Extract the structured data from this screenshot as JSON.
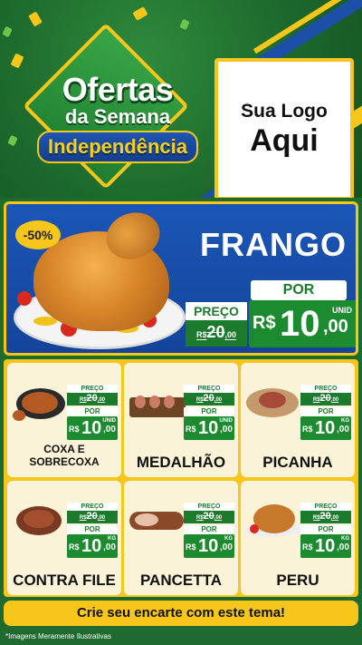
{
  "header": {
    "title_line1": "Ofertas",
    "title_line2": "da Semana",
    "title_da": "da",
    "title_line3": "Independência",
    "logo_line1": "Sua Logo",
    "logo_line2": "Aqui"
  },
  "hero": {
    "discount": "-50%",
    "name": "FRANGO",
    "preco_label": "PREÇO",
    "old_currency": "R$",
    "old_int": "20",
    "old_dec": ",00",
    "por_label": "POR",
    "currency": "R$",
    "price_int": "10",
    "price_dec": ",00",
    "unit": "UNID"
  },
  "products": [
    {
      "name": "COXA E SOBRECOXA",
      "preco_label": "PREÇO",
      "old_currency": "R$",
      "old_int": "20",
      "old_dec": ",00",
      "por_label": "POR",
      "currency": "R$",
      "price_int": "10",
      "price_dec": ",00",
      "unit": "UNID"
    },
    {
      "name": "MEDALHÃO",
      "preco_label": "PREÇO",
      "old_currency": "R$",
      "old_int": "20",
      "old_dec": ",00",
      "por_label": "POR",
      "currency": "R$",
      "price_int": "10",
      "price_dec": ",00",
      "unit": "UNID"
    },
    {
      "name": "PICANHA",
      "preco_label": "PREÇO",
      "old_currency": "R$",
      "old_int": "20",
      "old_dec": ",00",
      "por_label": "POR",
      "currency": "R$",
      "price_int": "10",
      "price_dec": ",00",
      "unit": "KG"
    },
    {
      "name": "CONTRA FILE",
      "preco_label": "PREÇO",
      "old_currency": "R$",
      "old_int": "20",
      "old_dec": ",00",
      "por_label": "POR",
      "currency": "R$",
      "price_int": "10",
      "price_dec": ",00",
      "unit": "KG"
    },
    {
      "name": "PANCETTA",
      "preco_label": "PREÇO",
      "old_currency": "R$",
      "old_int": "20",
      "old_dec": ",00",
      "por_label": "POR",
      "currency": "R$",
      "price_int": "10",
      "price_dec": ",00",
      "unit": "KG"
    },
    {
      "name": "PERU",
      "preco_label": "PREÇO",
      "old_currency": "R$",
      "old_int": "20",
      "old_dec": ",00",
      "por_label": "POR",
      "currency": "R$",
      "price_int": "10",
      "price_dec": ",00",
      "unit": "KG"
    }
  ],
  "footer": {
    "cta": "Crie seu encarte com este tema!",
    "disclaimer": "*Imagens Meramente Ilustrativas"
  },
  "colors": {
    "green_bg": "#1f6b2f",
    "blue_panel": "#1b56b7",
    "yellow": "#f6c71a",
    "price_green": "#1c8a2f",
    "card_bg": "#fbf3d8"
  }
}
